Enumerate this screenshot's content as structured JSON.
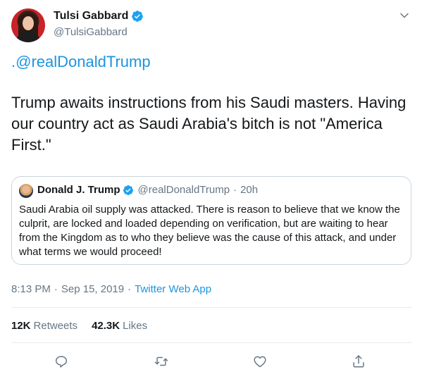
{
  "author": {
    "display_name": "Tulsi Gabbard",
    "handle": "@TulsiGabbard",
    "verified": true
  },
  "tweet": {
    "mention": ".@realDonaldTrump",
    "text": "Trump awaits instructions from his Saudi masters. Having our country act as Saudi Arabia's bitch is not \"America First.\""
  },
  "quoted_tweet": {
    "display_name": "Donald J. Trump",
    "handle": "@realDonaldTrump",
    "separator": "·",
    "time": "20h",
    "text": "Saudi Arabia oil supply was attacked. There is reason to believe that we know the culprit, are locked and loaded depending on verification, but are waiting to hear from the Kingdom as to who they believe was the cause of this attack, and under what terms we would proceed!"
  },
  "meta": {
    "time": "8:13 PM",
    "separator": "·",
    "date": "Sep 15, 2019",
    "source": "Twitter Web App"
  },
  "stats": {
    "retweets_count": "12K",
    "retweets_label": "Retweets",
    "likes_count": "42.3K",
    "likes_label": "Likes"
  },
  "icons": {
    "verified": "verified-badge-icon",
    "caret": "chevron-down-icon",
    "reply": "reply-icon",
    "retweet": "retweet-icon",
    "like": "heart-icon",
    "share": "share-icon"
  },
  "colors": {
    "accent": "#1b95e0",
    "text": "#14171a",
    "secondary": "#657786",
    "border": "#ccd6dd"
  }
}
